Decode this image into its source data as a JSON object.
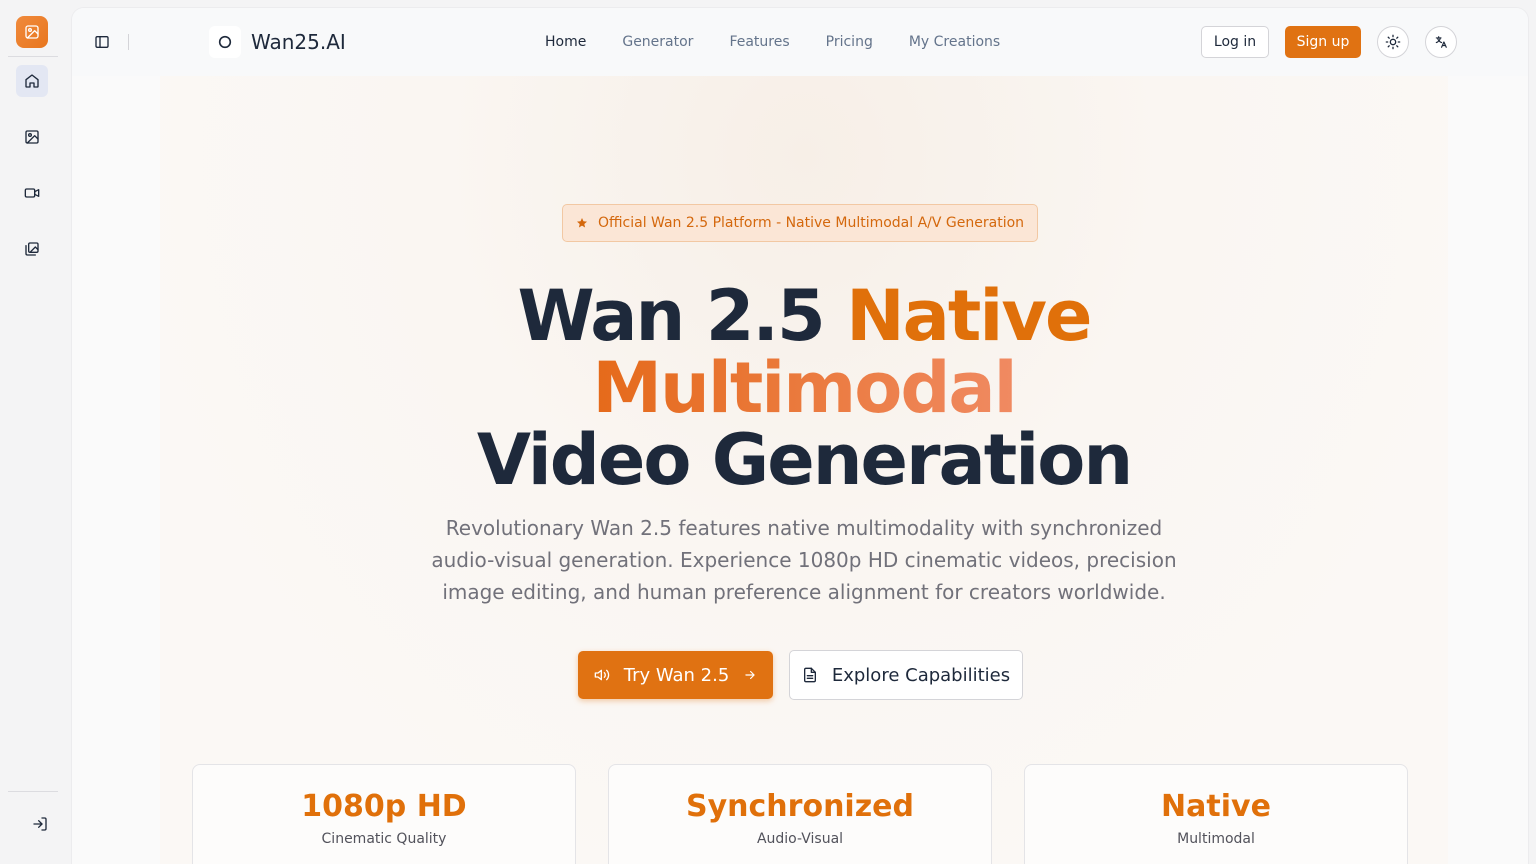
{
  "rail": {
    "logo_icon": "image-sparkle-icon",
    "items": [
      {
        "icon": "home-icon",
        "active": true
      },
      {
        "icon": "image-icon",
        "active": false
      },
      {
        "icon": "video-icon",
        "active": false
      },
      {
        "icon": "gallery-icon",
        "active": false
      }
    ],
    "bottom_icon": "sign-in-icon"
  },
  "header": {
    "brand": "Wan25.AI",
    "nav": [
      "Home",
      "Generator",
      "Features",
      "Pricing",
      "My Creations"
    ],
    "active_nav": "Home",
    "login_label": "Log in",
    "signup_label": "Sign up",
    "theme_icon": "sun-icon",
    "language_icon": "translate-icon"
  },
  "hero": {
    "badge": "Official Wan 2.5 Platform - Native Multimodal A/V Generation",
    "title_part1": "Wan 2.5 ",
    "title_part2": "Native",
    "title_part3": "Multimodal",
    "title_part4": "Video Generation",
    "lead": "Revolutionary Wan 2.5 features native multimodality with synchronized audio-visual generation. Experience 1080p HD cinematic videos, precision image editing, and human preference alignment for creators worldwide.",
    "cta_primary": "Try Wan 2.5",
    "cta_secondary": "Explore Capabilities"
  },
  "stats": [
    {
      "value": "1080p HD",
      "label": "Cinematic Quality"
    },
    {
      "value": "Synchronized",
      "label": "Audio-Visual"
    },
    {
      "value": "Native",
      "label": "Multimodal"
    }
  ],
  "colors": {
    "accent": "#e07212",
    "text_dark": "#1e293b",
    "muted": "#71717a"
  }
}
